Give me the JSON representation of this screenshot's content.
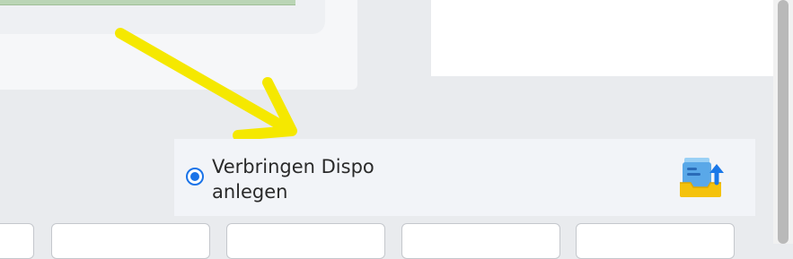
{
  "option": {
    "label_line1": "Verbringen Dispo",
    "label_line2": "anlegen",
    "selected": true,
    "icon": "tray-upload-icon"
  },
  "annotation": {
    "icon": "arrow-annotation-icon",
    "color": "#f5e800"
  },
  "colors": {
    "accent": "#1a73e8",
    "background": "#e9ebee",
    "card": "#f2f4f8"
  }
}
